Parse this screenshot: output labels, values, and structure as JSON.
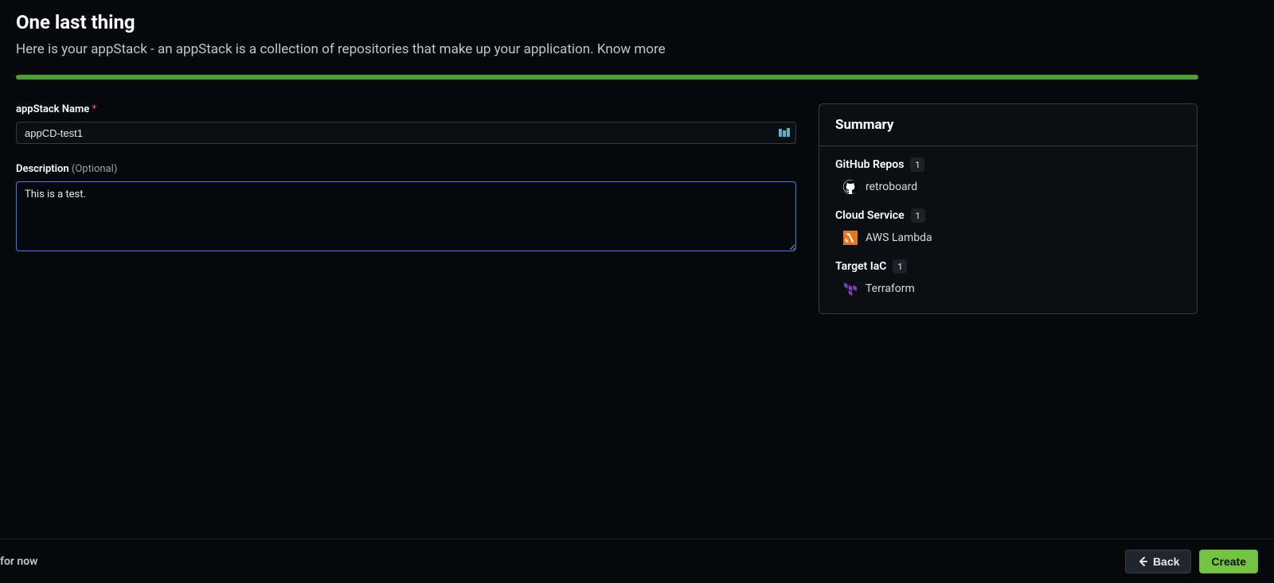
{
  "header": {
    "title": "One last thing",
    "subtitle_prefix": "Here is your appStack - an appStack is a collection of repositories that make up your application. ",
    "know_more": "Know more"
  },
  "form": {
    "name_label": "appStack Name",
    "required_mark": "*",
    "name_value": "appCD-test1",
    "description_label": "Description",
    "optional_mark": "(Optional)",
    "description_value": "This is a test."
  },
  "summary": {
    "title": "Summary",
    "sections": [
      {
        "label": "GitHub Repos",
        "count": "1",
        "items": [
          {
            "name": "retroboard",
            "icon": "github"
          }
        ]
      },
      {
        "label": "Cloud Service",
        "count": "1",
        "items": [
          {
            "name": "AWS Lambda",
            "icon": "aws-lambda"
          }
        ]
      },
      {
        "label": "Target IaC",
        "count": "1",
        "items": [
          {
            "name": "Terraform",
            "icon": "terraform"
          }
        ]
      }
    ]
  },
  "footer": {
    "skip": "for now",
    "back": "Back",
    "create": "Create"
  }
}
